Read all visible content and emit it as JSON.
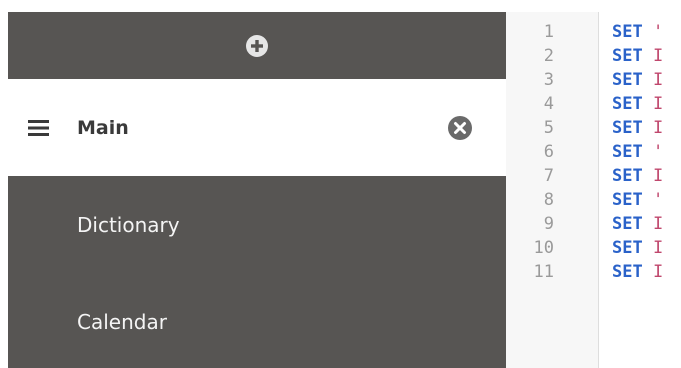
{
  "sidebar": {
    "add_button_label": "",
    "active_sheet": {
      "label": "Main"
    },
    "sheets": [
      {
        "label": "Dictionary"
      },
      {
        "label": "Calendar"
      }
    ]
  },
  "editor": {
    "lines": [
      {
        "number": "1",
        "keyword": "SET",
        "tail": "'"
      },
      {
        "number": "2",
        "keyword": "SET",
        "tail": "I"
      },
      {
        "number": "3",
        "keyword": "SET",
        "tail": "I"
      },
      {
        "number": "4",
        "keyword": "SET",
        "tail": "I"
      },
      {
        "number": "5",
        "keyword": "SET",
        "tail": "I"
      },
      {
        "number": "6",
        "keyword": "SET",
        "tail": "'"
      },
      {
        "number": "7",
        "keyword": "SET",
        "tail": "I"
      },
      {
        "number": "8",
        "keyword": "SET",
        "tail": "'"
      },
      {
        "number": "9",
        "keyword": "SET",
        "tail": "I"
      },
      {
        "number": "10",
        "keyword": "SET",
        "tail": "I"
      },
      {
        "number": "11",
        "keyword": "SET",
        "tail": "I"
      }
    ]
  },
  "colors": {
    "sidebar_bg": "#575553",
    "active_item_bg": "#ffffff",
    "keyword": "#2a62c9",
    "tail": "#c0476d",
    "line_number": "#9a9a9a"
  },
  "icons": [
    "plus-circle-icon",
    "hamburger-icon",
    "close-circle-icon"
  ]
}
